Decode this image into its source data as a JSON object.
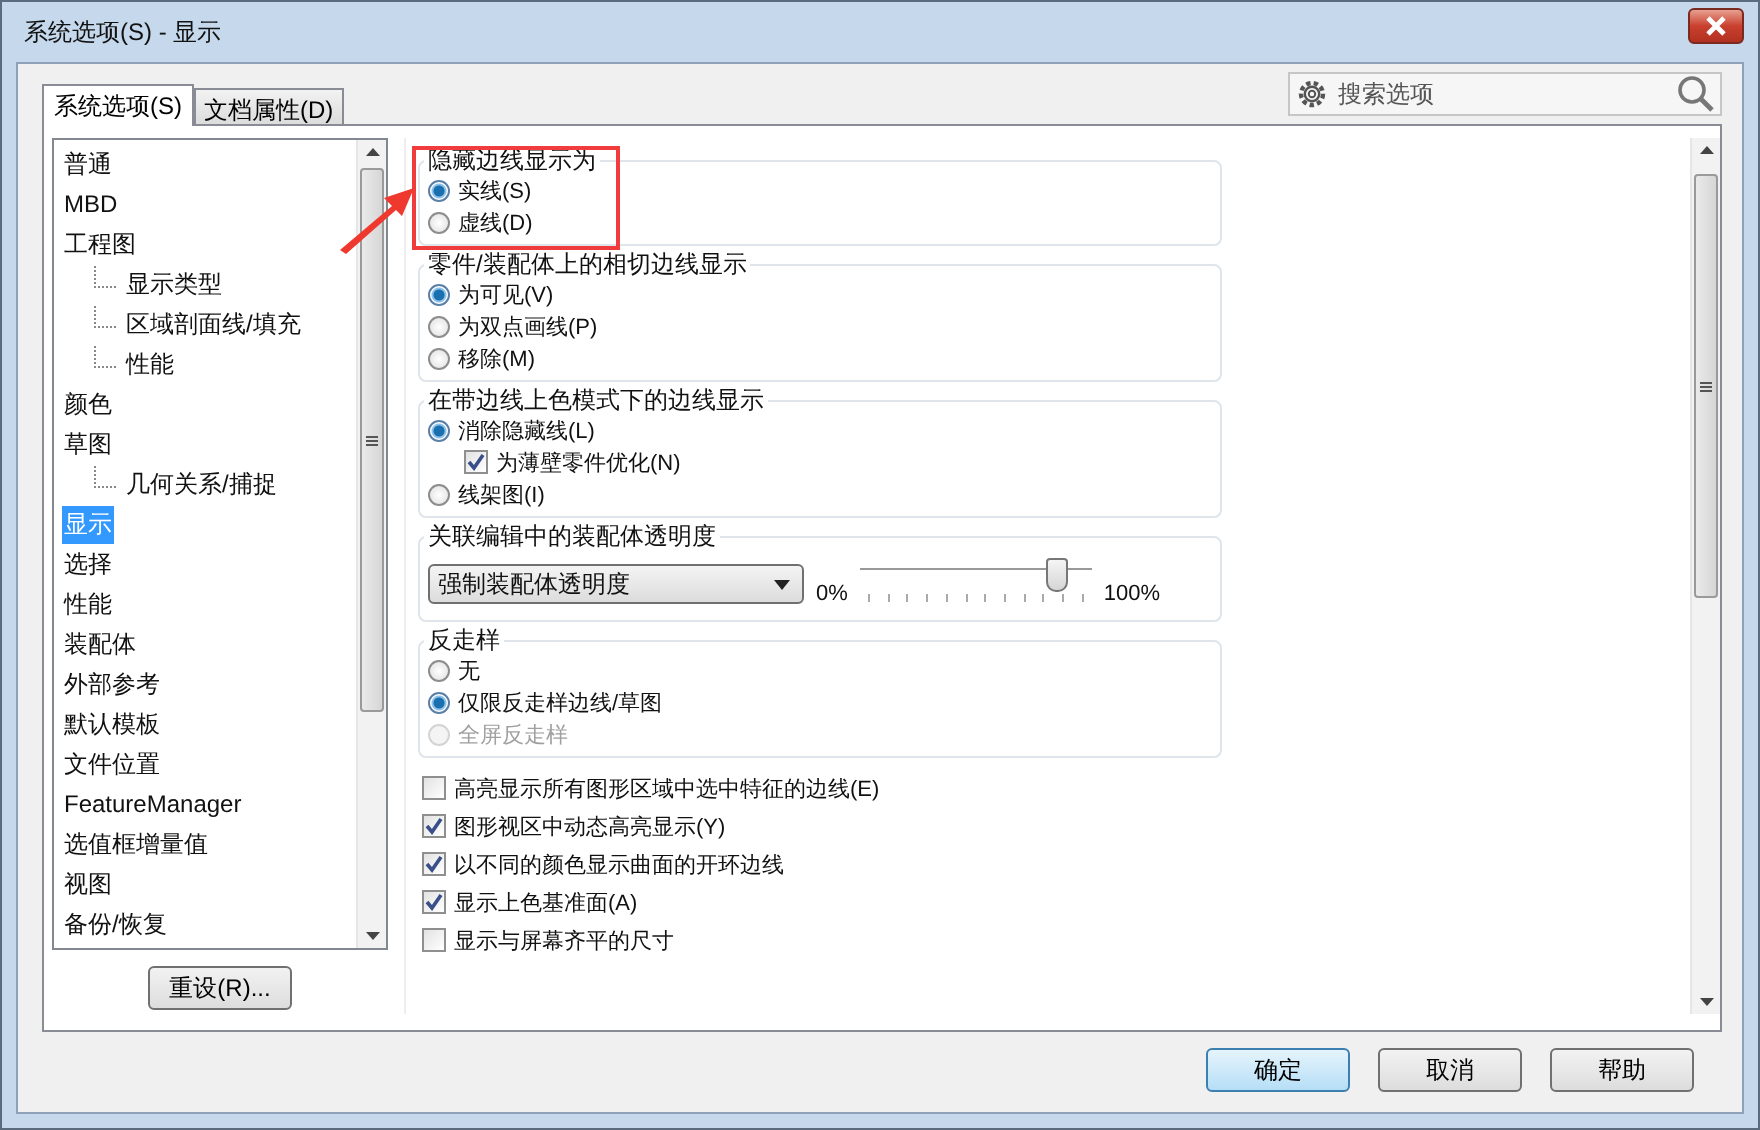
{
  "window": {
    "title": "系统选项(S) - 显示"
  },
  "tabs": [
    {
      "label": "系统选项(S)",
      "selected": true
    },
    {
      "label": "文档属性(D)",
      "selected": false
    }
  ],
  "search": {
    "placeholder": "搜索选项"
  },
  "tree": [
    {
      "label": "普通",
      "selected": false
    },
    {
      "label": "MBD",
      "selected": false
    },
    {
      "label": "工程图",
      "selected": false,
      "children": [
        {
          "label": "显示类型",
          "selected": false
        },
        {
          "label": "区域剖面线/填充",
          "selected": false
        },
        {
          "label": "性能",
          "selected": false
        }
      ]
    },
    {
      "label": "颜色",
      "selected": false
    },
    {
      "label": "草图",
      "selected": false,
      "children": [
        {
          "label": "几何关系/捕捉",
          "selected": false
        }
      ]
    },
    {
      "label": "显示",
      "selected": true
    },
    {
      "label": "选择",
      "selected": false
    },
    {
      "label": "性能",
      "selected": false
    },
    {
      "label": "装配体",
      "selected": false
    },
    {
      "label": "外部参考",
      "selected": false
    },
    {
      "label": "默认模板",
      "selected": false
    },
    {
      "label": "文件位置",
      "selected": false
    },
    {
      "label": "FeatureManager",
      "selected": false
    },
    {
      "label": "选值框增量值",
      "selected": false
    },
    {
      "label": "视图",
      "selected": false
    },
    {
      "label": "备份/恢复",
      "selected": false
    }
  ],
  "reset_button": "重设(R)...",
  "sections": [
    {
      "kind": "group",
      "title": "隐藏边线显示为",
      "highlighted": true,
      "items": [
        {
          "kind": "radio",
          "label": "实线(S)",
          "selected": true,
          "disabled": false
        },
        {
          "kind": "radio",
          "label": "虚线(D)",
          "selected": false,
          "disabled": false
        }
      ]
    },
    {
      "kind": "group",
      "title": "零件/装配体上的相切边线显示",
      "highlighted": false,
      "items": [
        {
          "kind": "radio",
          "label": "为可见(V)",
          "selected": true,
          "disabled": false
        },
        {
          "kind": "radio",
          "label": "为双点画线(P)",
          "selected": false,
          "disabled": false
        },
        {
          "kind": "radio",
          "label": "移除(M)",
          "selected": false,
          "disabled": false
        }
      ]
    },
    {
      "kind": "group",
      "title": "在带边线上色模式下的边线显示",
      "highlighted": false,
      "items": [
        {
          "kind": "radio",
          "label": "消除隐藏线(L)",
          "selected": true,
          "disabled": false
        },
        {
          "kind": "checkbox",
          "label": "为薄壁零件优化(N)",
          "checked": true,
          "disabled": false
        },
        {
          "kind": "radio",
          "label": "线架图(I)",
          "selected": false,
          "disabled": false
        }
      ]
    },
    {
      "kind": "transparency",
      "title": "关联编辑中的装配体透明度",
      "dropdown": "强制装配体透明度",
      "level": 0.85,
      "min_label": "0%",
      "max_label": "100%"
    },
    {
      "kind": "group",
      "title": "反走样",
      "highlighted": false,
      "items": [
        {
          "kind": "radio",
          "label": "无",
          "selected": false,
          "disabled": false
        },
        {
          "kind": "radio",
          "label": "仅限反走样边线/草图",
          "selected": true,
          "disabled": false
        },
        {
          "kind": "radio",
          "label": "全屏反走样",
          "selected": false,
          "disabled": true
        }
      ]
    },
    {
      "kind": "checklist",
      "items": [
        {
          "kind": "checkbox",
          "label": "高亮显示所有图形区域中选中特征的边线(E)",
          "checked": false
        },
        {
          "kind": "checkbox",
          "label": "图形视区中动态高亮显示(Y)",
          "checked": true
        },
        {
          "kind": "checkbox",
          "label": "以不同的颜色显示曲面的开环边线",
          "checked": true
        },
        {
          "kind": "checkbox",
          "label": "显示上色基准面(A)",
          "checked": true
        },
        {
          "kind": "checkbox",
          "label": "显示与屏幕齐平的尺寸",
          "checked": false
        }
      ]
    }
  ],
  "buttons": [
    {
      "label": "确定",
      "default": true
    },
    {
      "label": "取消",
      "default": false
    },
    {
      "label": "帮助",
      "default": false
    }
  ]
}
